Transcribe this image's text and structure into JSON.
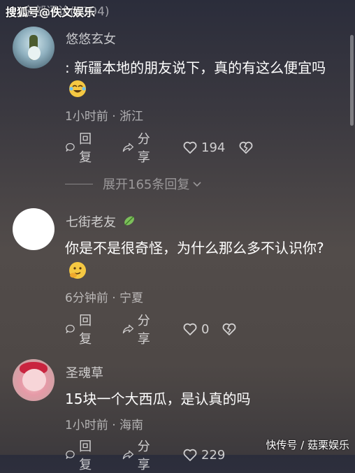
{
  "header": {
    "title": "全部评论(2394)",
    "watermark": "搜狐号@佚文娱乐"
  },
  "comments": [
    {
      "name": "悠悠玄女",
      "text": ": 新疆本地的朋友说下，真的有这么便宜吗",
      "emoji": "laughing-crying-emoji",
      "meta": "1小时前 · 浙江",
      "reply_label": "回复",
      "share_label": "分享",
      "like_count": "194",
      "expand_label": "展开165条回复"
    },
    {
      "name": "七街老友",
      "name_badge": "leaf-badge-icon",
      "text": "你是不是很奇怪，为什么那么多不认识你?",
      "emoji": "smirk-hand-emoji",
      "meta": "6分钟前 · 宁夏",
      "reply_label": "回复",
      "share_label": "分享",
      "like_count": "0"
    },
    {
      "name": "圣魂草",
      "text": "15块一个大西瓜，是认真的吗",
      "meta": "1小时前 · 海南",
      "reply_label": "回复",
      "share_label": "分享",
      "like_count": "229"
    }
  ],
  "footer": {
    "watermark": "快传号 / 菇栗娱乐"
  },
  "colors": {
    "text_primary": "#ffffff",
    "text_secondary": "#b5b1b0",
    "emoji_yellow": "#f5c842"
  }
}
